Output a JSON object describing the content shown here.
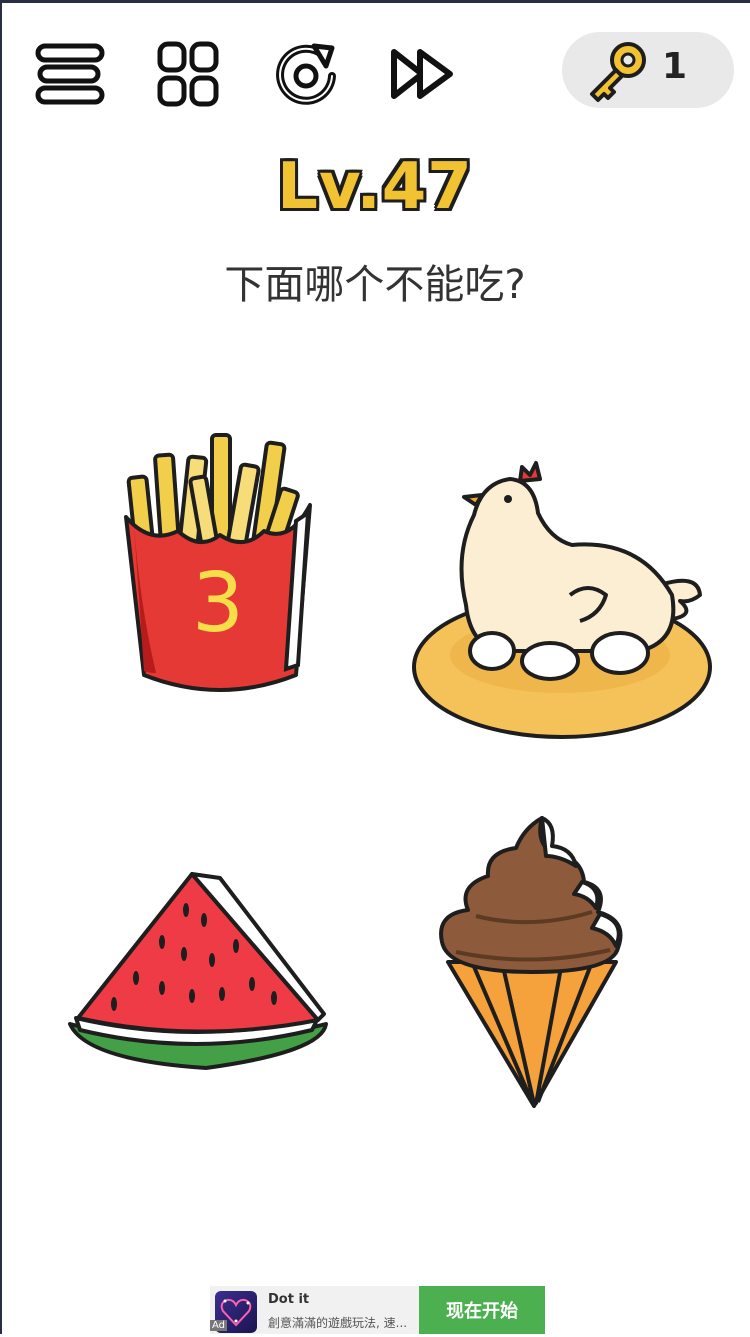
{
  "toolbar": {
    "icons": [
      "menu-icon",
      "level-grid-icon",
      "restart-icon",
      "skip-icon",
      "key-icon"
    ],
    "key_count": "1"
  },
  "level": {
    "label": "Lv.47",
    "question": "下面哪个不能吃?"
  },
  "options": [
    {
      "id": "fries",
      "name": "french-fries",
      "box_number": "3"
    },
    {
      "id": "hen",
      "name": "hen-on-nest"
    },
    {
      "id": "watermelon",
      "name": "watermelon-slice"
    },
    {
      "id": "icecream",
      "name": "ice-cream-cone"
    }
  ],
  "ad": {
    "title": "Dot it",
    "description": "創意滿滿的遊戲玩法, 速...",
    "cta": "现在开始",
    "tag": "Ad"
  },
  "colors": {
    "level_yellow": "#f1c232",
    "key_gold": "#f1c232",
    "fries_red": "#e53935",
    "ad_green": "#4caf50"
  }
}
